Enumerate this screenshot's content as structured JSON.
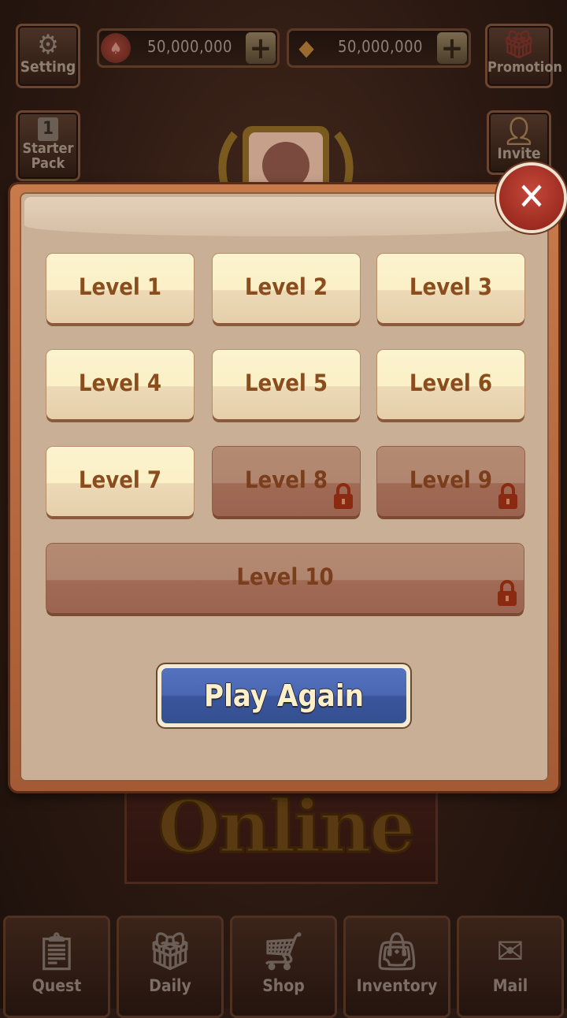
{
  "top": {
    "setting_label": "Setting",
    "chips_value": "50,000,000",
    "gems_value": "50,000,000",
    "promotion_label": "Promotion",
    "starter_pack_label": "Starter Pack",
    "starter_pack_count": "1",
    "invite_label": "Invite"
  },
  "logo_text": "Online",
  "dialog": {
    "close_label": "✕",
    "levels": [
      {
        "label": "Level 1",
        "locked": false
      },
      {
        "label": "Level 2",
        "locked": false
      },
      {
        "label": "Level 3",
        "locked": false
      },
      {
        "label": "Level 4",
        "locked": false
      },
      {
        "label": "Level 5",
        "locked": false
      },
      {
        "label": "Level 6",
        "locked": false
      },
      {
        "label": "Level 7",
        "locked": false
      },
      {
        "label": "Level 8",
        "locked": true
      },
      {
        "label": "Level 9",
        "locked": true
      },
      {
        "label": "Level 10",
        "locked": true
      }
    ],
    "play_again_label": "Play Again"
  },
  "bottom_nav": [
    {
      "label": "Quest",
      "icon": "quest-icon"
    },
    {
      "label": "Daily",
      "icon": "gift-icon"
    },
    {
      "label": "Shop",
      "icon": "cart-icon"
    },
    {
      "label": "Inventory",
      "icon": "bag-icon"
    },
    {
      "label": "Mail",
      "icon": "mail-icon"
    }
  ],
  "colors": {
    "accent_blue": "#4a67b3",
    "close_red": "#a82d22",
    "level_text": "#8a4d1e"
  }
}
